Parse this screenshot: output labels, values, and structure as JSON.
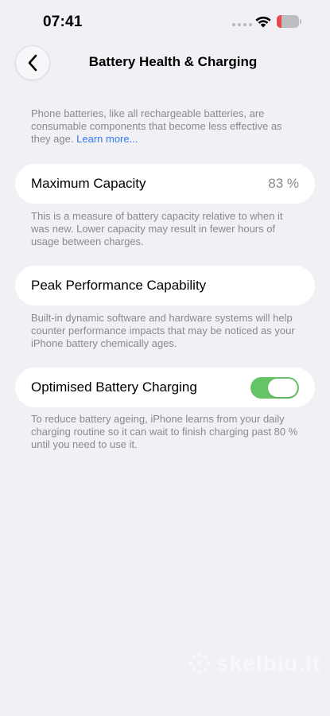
{
  "status_bar": {
    "time": "07:41",
    "battery_level_fraction": 0.2,
    "battery_color": "#e5484d"
  },
  "nav": {
    "back_icon": "chevron-left-icon",
    "title": "Battery Health & Charging"
  },
  "intro": {
    "text": "Phone batteries, like all rechargeable batteries, are consumable components that become less effective as they age.",
    "link": "Learn more..."
  },
  "max_capacity": {
    "label": "Maximum Capacity",
    "value": "83 %",
    "description": "This is a measure of battery capacity relative to when it was new. Lower capacity may result in fewer hours of usage between charges."
  },
  "peak_performance": {
    "label": "Peak Performance Capability",
    "description": "Built-in dynamic software and hardware systems will help counter performance impacts that may be noticed as your iPhone battery chemically ages."
  },
  "optimised_charging": {
    "label": "Optimised Battery Charging",
    "enabled": true,
    "toggle_color": "#65c466",
    "description": "To reduce battery ageing, iPhone learns from your daily charging routine so it can wait to finish charging past 80 % until you need to use it."
  },
  "watermark": {
    "text": "skelbiu.lt"
  }
}
